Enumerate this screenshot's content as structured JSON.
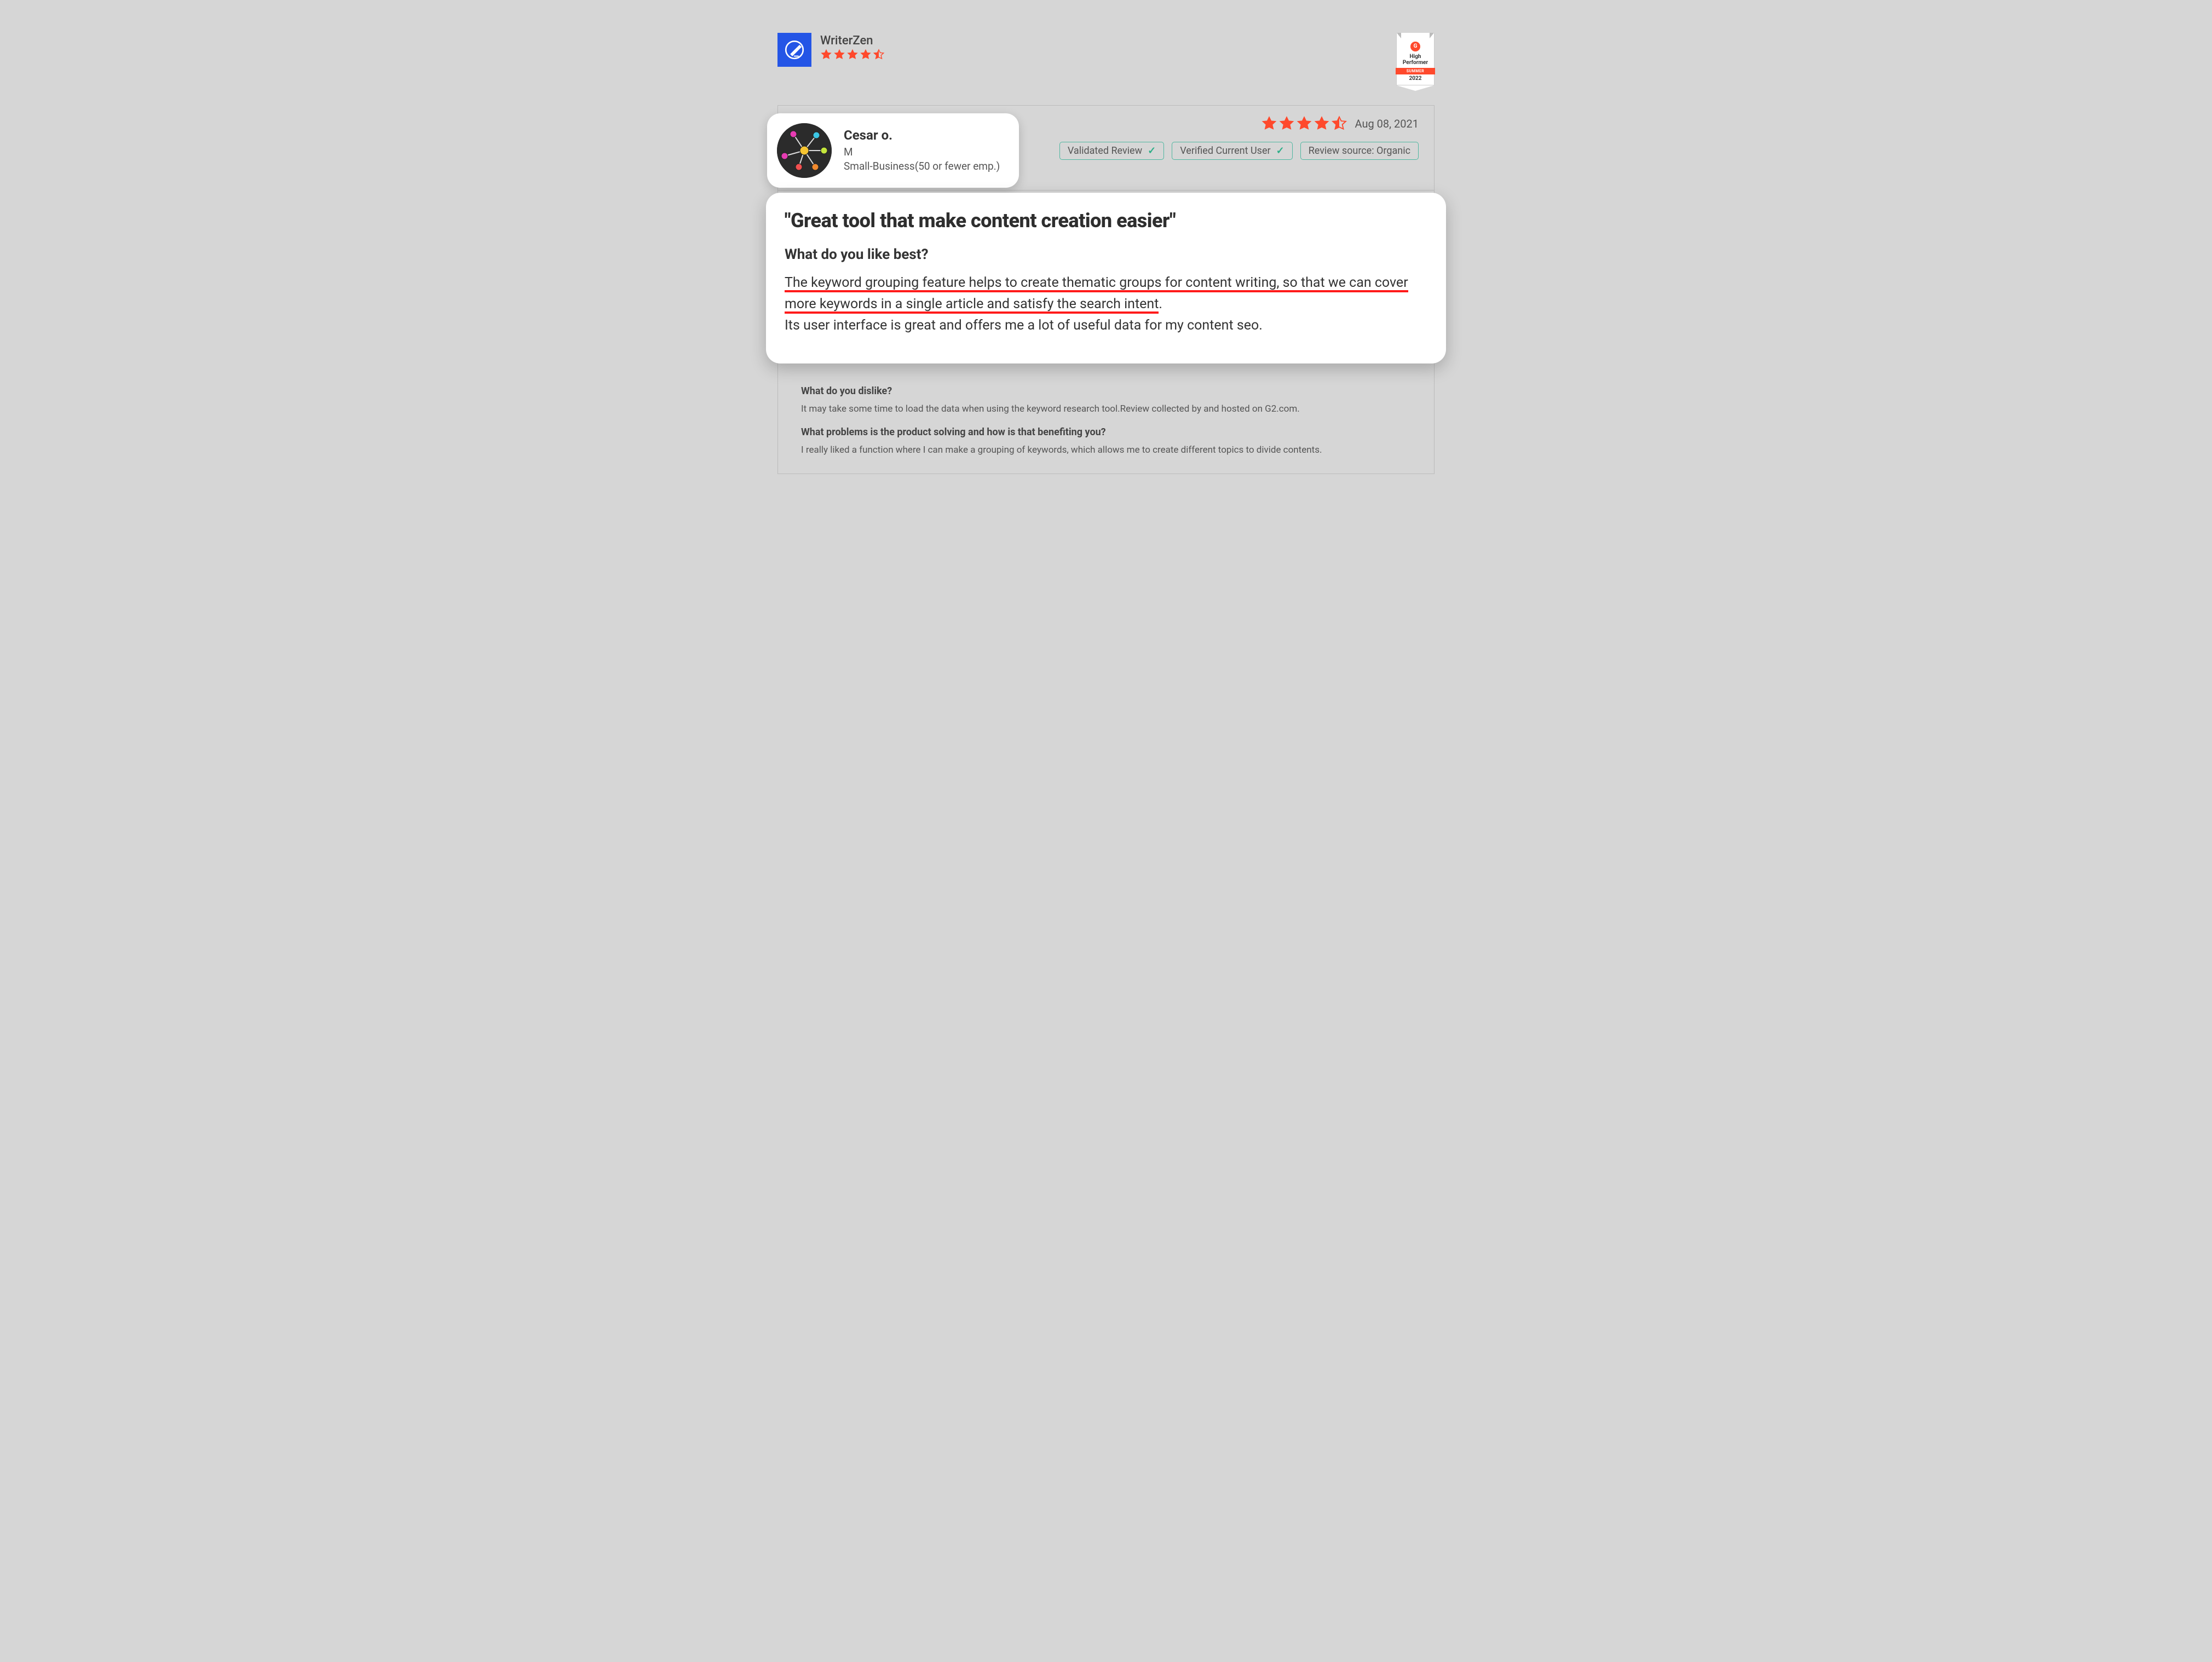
{
  "product": {
    "name": "WriterZen",
    "rating": 4.5
  },
  "g2_badge": {
    "logo_text": "G",
    "label": "High Performer",
    "ribbon": "SUMMER",
    "year": "2022"
  },
  "review": {
    "reviewer": {
      "name": "Cesar o.",
      "line1": "M",
      "line2": "Small-Business(50 or fewer emp.)"
    },
    "rating": 4.5,
    "date": "Aug 08, 2021",
    "badges": {
      "b1": "Validated Review",
      "b2": "Verified Current User",
      "b3": "Review source: Organic"
    },
    "title": "\"Great tool that make content creation easier\"",
    "q1": "What do you like best?",
    "a1_highlight": "The keyword grouping feature helps to create thematic groups for content writing, so that we can cover more keywords in a single article and satisfy the search intent",
    "a1_punct": ".",
    "a1_rest": "Its user interface is great and offers me a lot of useful data for my content seo.",
    "q2": "What do you dislike?",
    "a2": "It may take some time to load the data when using the keyword research tool.Review collected by and hosted on G2.com.",
    "q3": "What problems is the product solving and how is that benefiting you?",
    "a3": "I really liked a function where I can make a grouping of keywords, which allows me to create different topics to divide contents."
  }
}
